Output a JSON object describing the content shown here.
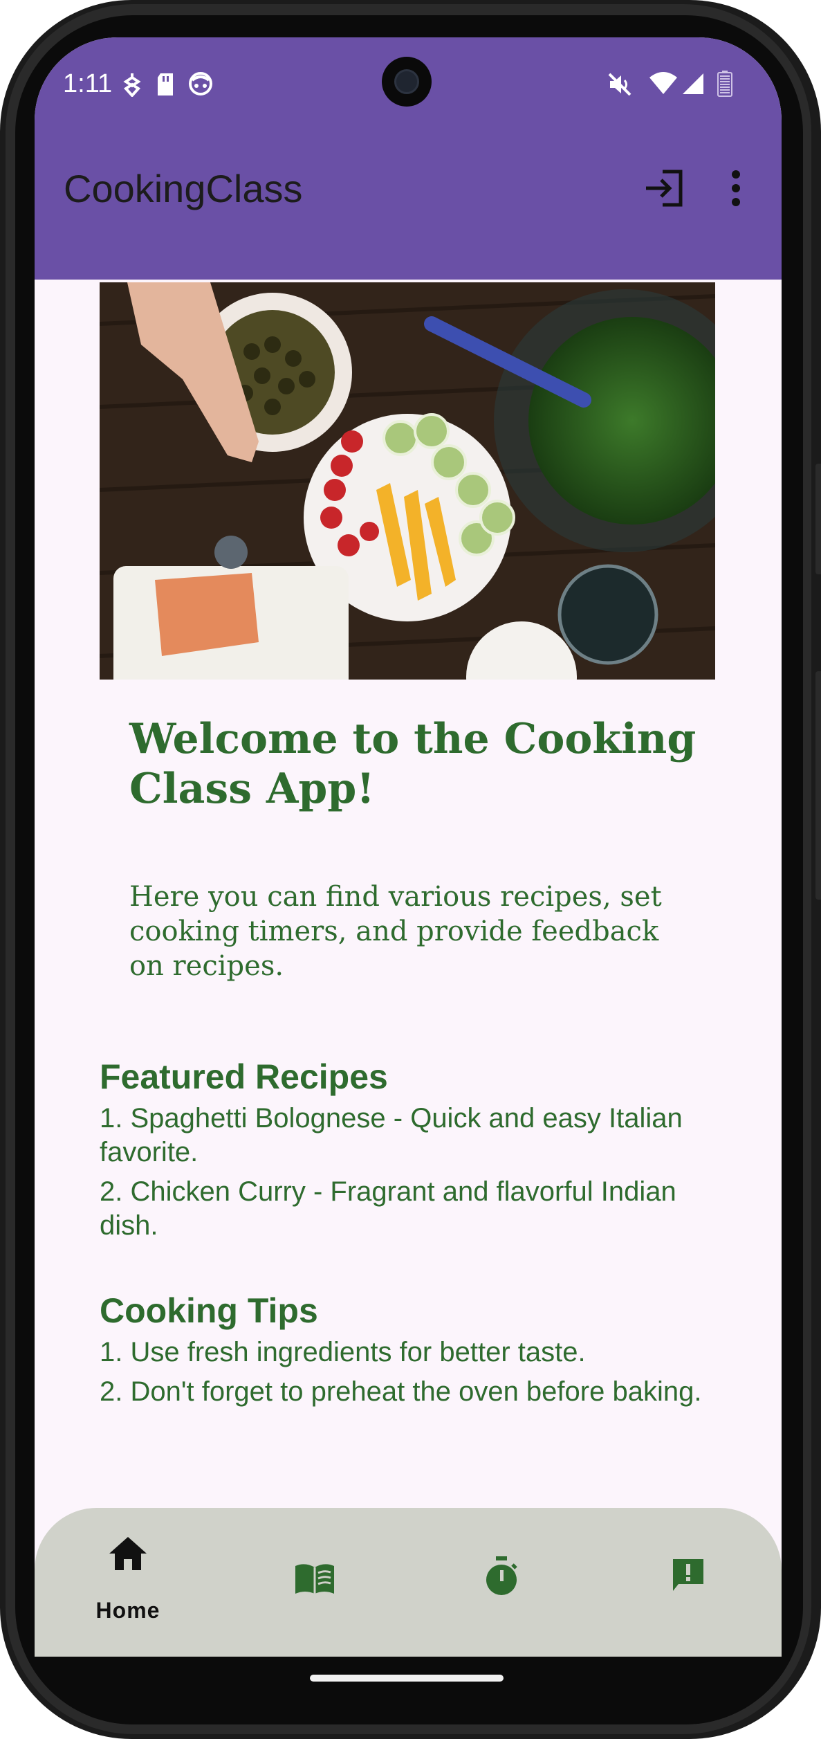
{
  "status_bar": {
    "time": "1:11",
    "left_icons": [
      "notification-icon",
      "sd-card-icon",
      "face-icon"
    ],
    "right_icons": [
      "mute-icon",
      "wifi-icon",
      "signal-icon",
      "battery-icon"
    ]
  },
  "app_bar": {
    "title": "CookingClass",
    "actions": [
      "login-icon",
      "more-vert-icon"
    ],
    "color": "#6a50a6"
  },
  "content": {
    "welcome_title": "Welcome to the Cooking Class App!",
    "intro": "Here you can find various recipes, set cooking timers, and provide feedback on recipes.",
    "featured": {
      "title": "Featured Recipes",
      "items": [
        "1. Spaghetti Bolognese - Quick and easy Italian favorite.",
        "2. Chicken Curry - Fragrant and flavorful Indian dish."
      ]
    },
    "tips": {
      "title": "Cooking Tips",
      "items": [
        "1. Use fresh ingredients for better taste.",
        "2. Don't forget to preheat the oven before baking."
      ]
    },
    "text_color": "#2e6b2e"
  },
  "bottom_nav": {
    "items": [
      {
        "icon": "home-icon",
        "label": "Home",
        "selected": true
      },
      {
        "icon": "book-icon",
        "label": "",
        "selected": false
      },
      {
        "icon": "timer-icon",
        "label": "",
        "selected": false
      },
      {
        "icon": "feedback-icon",
        "label": "",
        "selected": false
      }
    ],
    "background": "#d0d2ca",
    "icon_color": "#2e6b2e"
  }
}
